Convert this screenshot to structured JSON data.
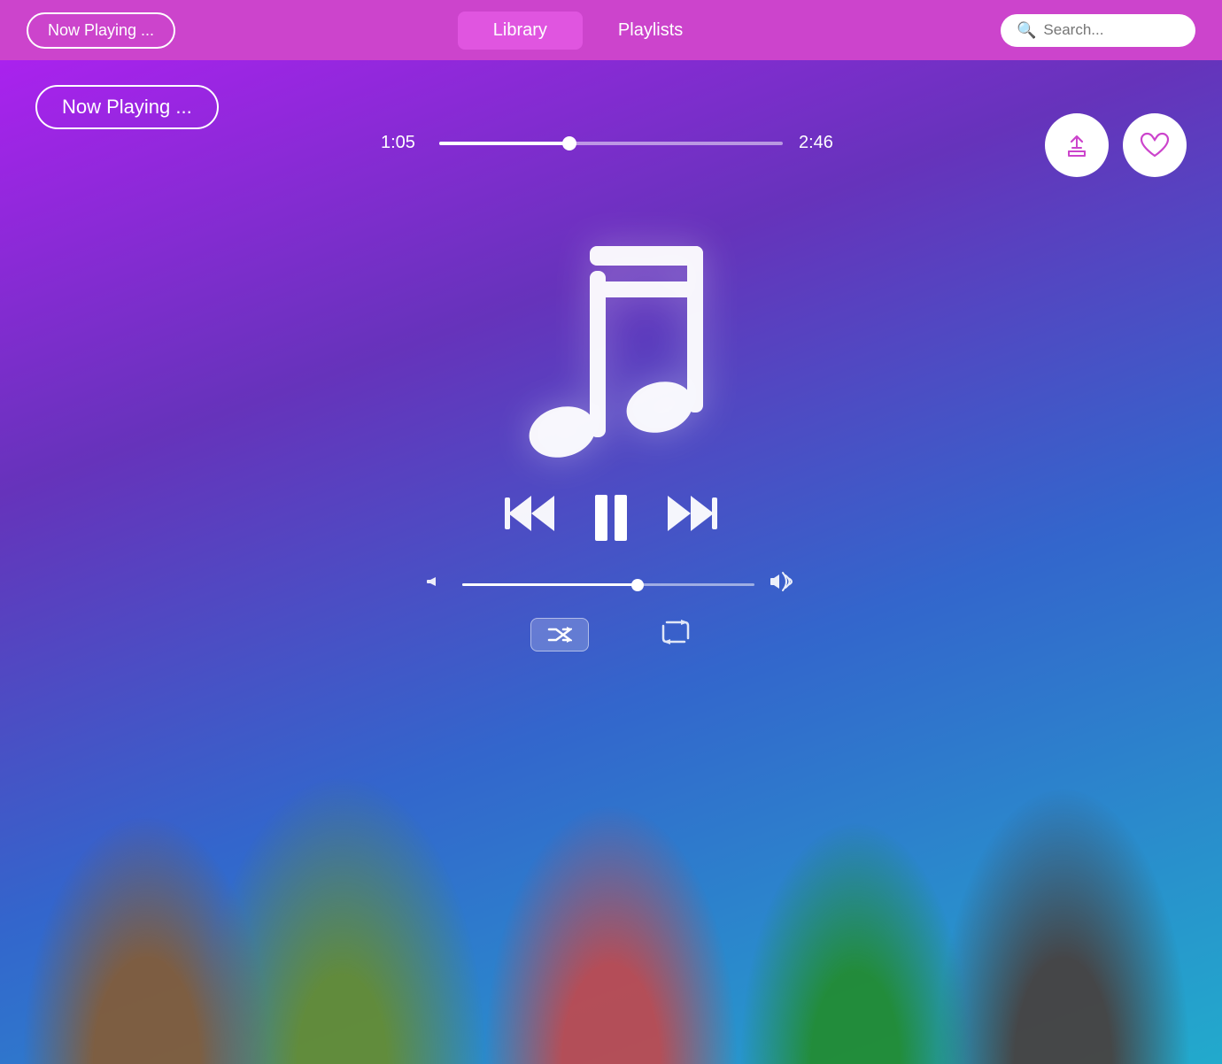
{
  "topnav": {
    "now_playing_label": "Now Playing ...",
    "library_label": "Library",
    "playlists_label": "Playlists",
    "search_placeholder": "Search..."
  },
  "player": {
    "now_playing_label": "Now Playing ...",
    "current_time": "1:05",
    "total_time": "2:46",
    "progress_pct": 38,
    "volume_pct": 60,
    "share_icon": "⬆",
    "heart_icon": "♡",
    "rewind_icon": "⏮",
    "pause_icon": "⏸",
    "fast_forward_icon": "⏭",
    "vol_low_icon": "🔇",
    "vol_high_icon": "🔊",
    "shuffle_label": "⇌",
    "repeat_label": "↺"
  }
}
